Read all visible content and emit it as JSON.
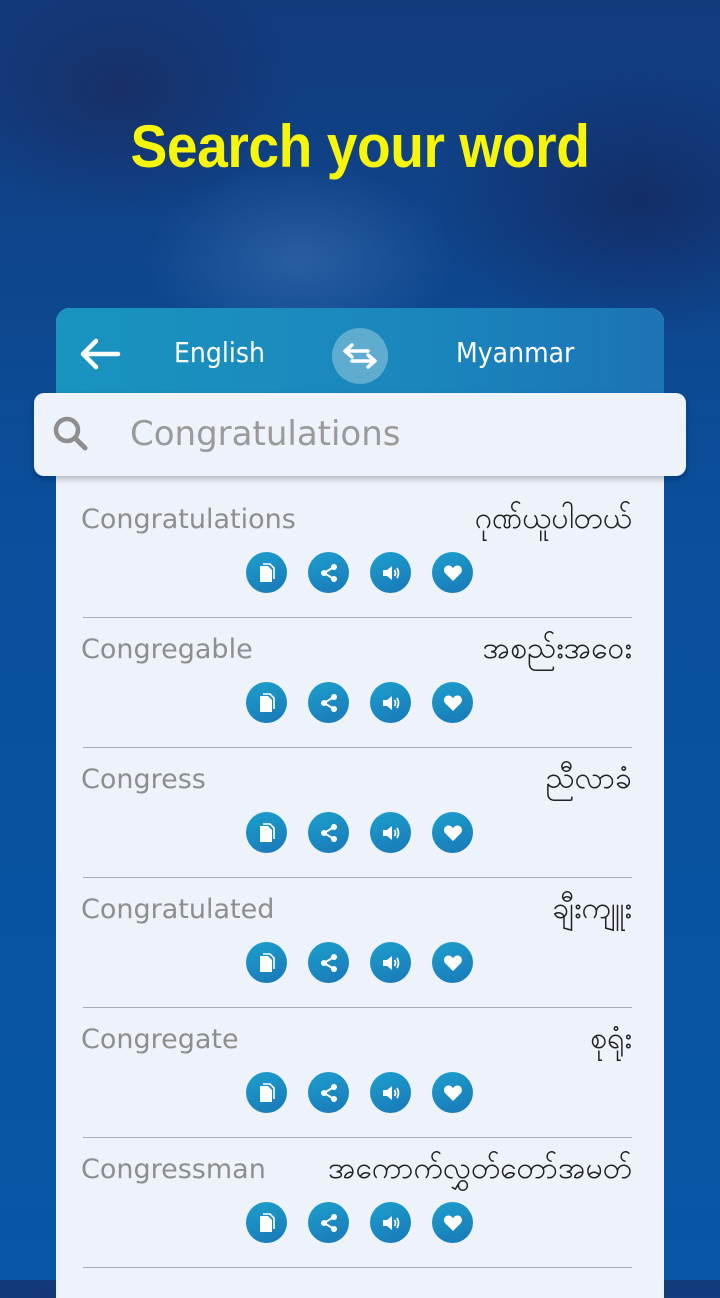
{
  "headline": "Search your word",
  "header": {
    "source_language": "English",
    "target_language": "Myanmar",
    "back_icon": "arrow-left-icon",
    "swap_icon": "swap-arrows-icon"
  },
  "search": {
    "value": "",
    "placeholder": "Congratulations",
    "icon": "search-icon"
  },
  "actions": [
    "copy",
    "share",
    "speak",
    "favorite"
  ],
  "results": [
    {
      "english": "Congratulations",
      "myanmar": "ဂုဏ်ယူပါတယ်"
    },
    {
      "english": "Congregable",
      "myanmar": "အစည်းအဝေး"
    },
    {
      "english": "Congress",
      "myanmar": "ညီလာခံ"
    },
    {
      "english": "Congratulated",
      "myanmar": "ချီးကျူး"
    },
    {
      "english": "Congregate",
      "myanmar": "စုရုံး"
    },
    {
      "english": "Congressman",
      "myanmar": "အကောက်လွှတ်တော်အမတ်"
    }
  ],
  "colors": {
    "headline": "#f7f50a",
    "header_bar": "#1a86bd",
    "action_button": "#1a8cc2",
    "panel": "#eef2fb"
  }
}
